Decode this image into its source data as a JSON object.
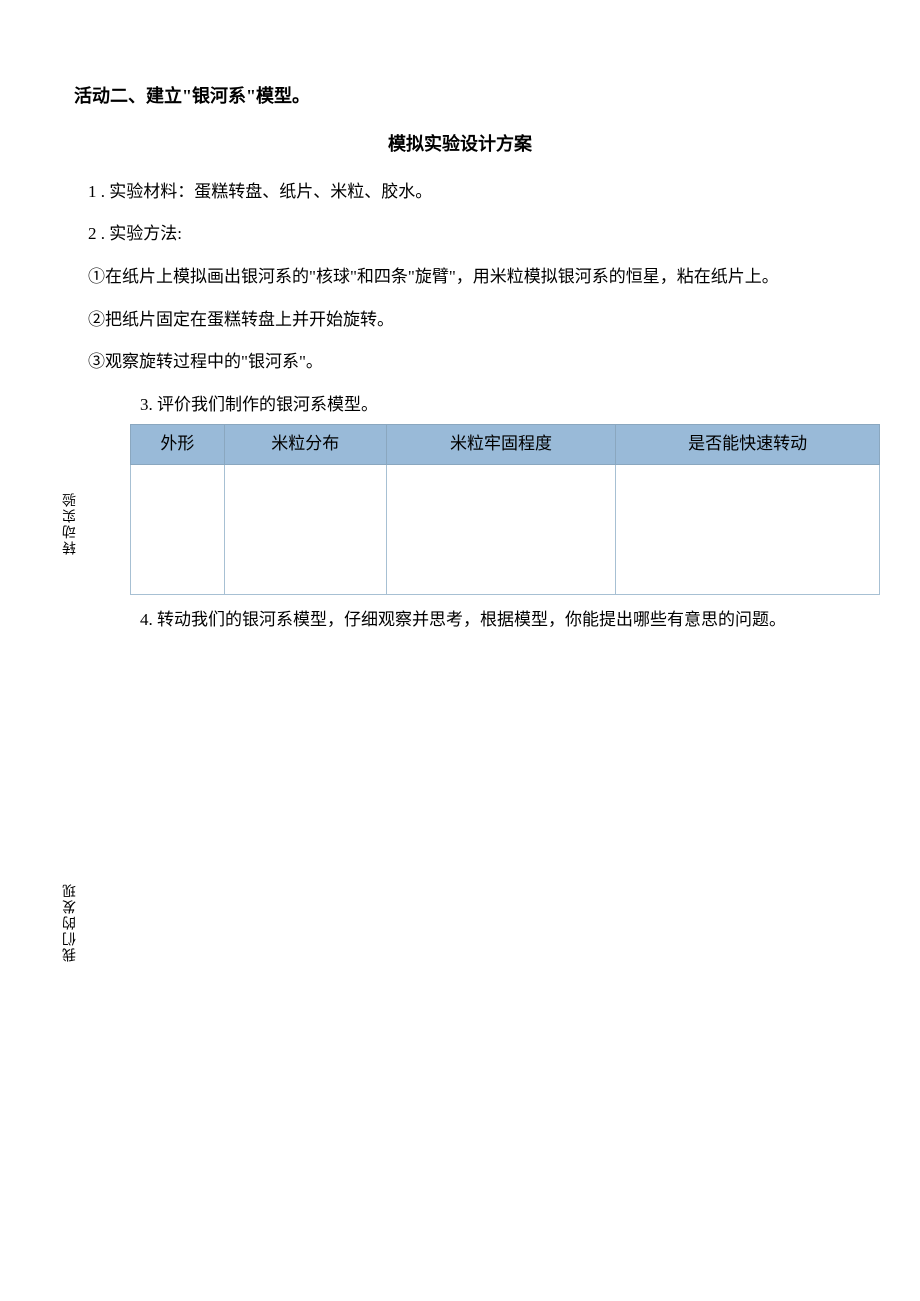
{
  "activity_title": "活动二、建立\"银河系\"模型。",
  "plan_title": "模拟实验设计方案",
  "materials_line": "1 . 实验材料：蛋糕转盘、纸片、米粒、胶水。",
  "method_label": "2  . 实验方法:",
  "method_steps": {
    "step1": "①在纸片上模拟画出银河系的\"核球\"和四条\"旋臂\"，用米粒模拟银河系的恒星，粘在纸片上。",
    "step2": "②把纸片固定在蛋糕转盘上并开始旋转。",
    "step3": "③观察旋转过程中的\"银河系\"。"
  },
  "eval_label": "3. 评价我们制作的银河系模型。",
  "side_label_1": "转动实验",
  "table_headers": {
    "col1": "外形",
    "col2": "米粒分布",
    "col3": "米粒牢固程度",
    "col4": "是否能快速转动"
  },
  "question_line": "4. 转动我们的银河系模型，仔细观察并思考，根据模型，你能提出哪些有意思的问题。",
  "side_label_2": "我们的发现"
}
